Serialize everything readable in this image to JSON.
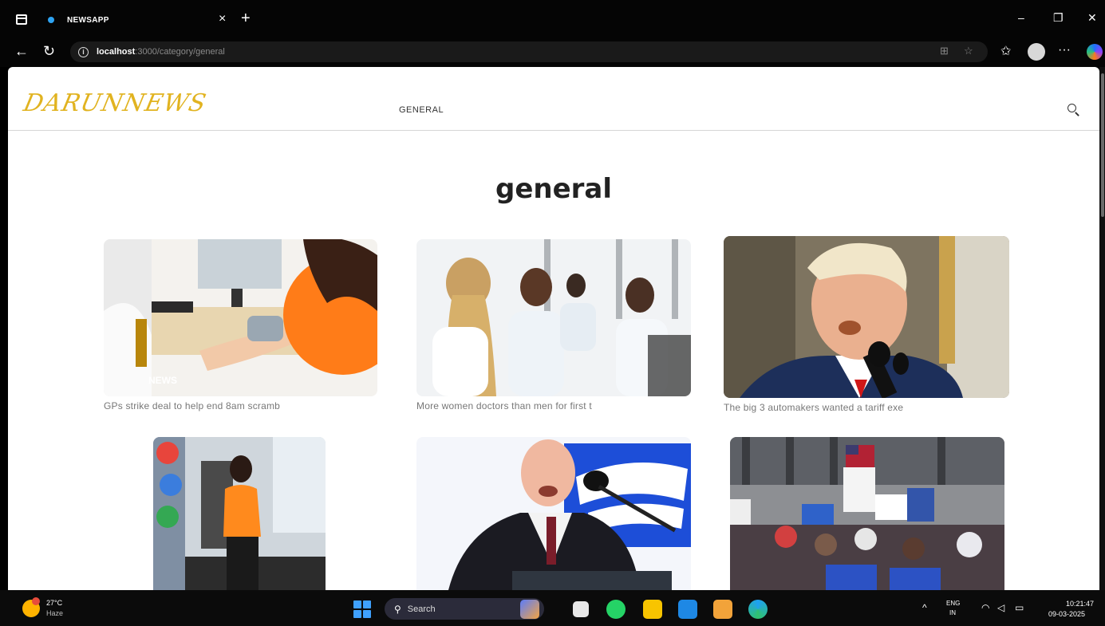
{
  "browser": {
    "tab_title": "NEWSAPP",
    "tab_close": "×",
    "new_tab": "+",
    "url_host": "localhost",
    "url_path": ":3000/category/general",
    "more_menu": "···",
    "window_controls": {
      "minimize": "–",
      "restore": "❐",
      "close": "✕"
    }
  },
  "site": {
    "brand": "DARUNNEWS",
    "nav_links": [
      "GENERAL"
    ],
    "heading": "general"
  },
  "articles": [
    {
      "title": "GPs strike deal to help end 8am scramb",
      "badge": "NEWS",
      "image": "clinic-blood-pressure-photo"
    },
    {
      "title": "More women doctors than men for first t",
      "image": "women-doctors-photo"
    },
    {
      "title": "The big 3 automakers wanted a tariff exe",
      "image": "speaker-microphone-photo"
    },
    {
      "title": "",
      "image": "office-woman-photo"
    },
    {
      "title": "",
      "image": "postal-official-speech-photo"
    },
    {
      "title": "",
      "image": "street-protest-photo"
    }
  ],
  "taskbar": {
    "weather_temp": "27°C",
    "weather_desc": "Haze",
    "search_label": "Search",
    "lang_top": "ENG",
    "lang_bottom": "IN",
    "time": "10:21:47",
    "date": "09-03-2025"
  },
  "colors": {
    "brand": "#e1b320",
    "heading": "#222222",
    "card_title": "#777777"
  }
}
